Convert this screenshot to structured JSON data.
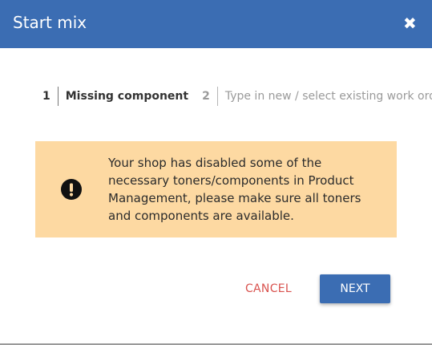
{
  "dialog": {
    "title": "Start mix",
    "close_icon": "close-icon"
  },
  "steps": [
    {
      "number": "1",
      "label": "Missing component",
      "active": true
    },
    {
      "number": "2",
      "label": "Type in new / select existing work order",
      "active": false
    }
  ],
  "alert": {
    "icon": "exclamation-circle-icon",
    "message": "Your shop has disabled some of the necessary toners/components in Product Management, please make sure all toners and components are available.",
    "background_color": "#fdd9a2"
  },
  "actions": {
    "cancel_label": "CANCEL",
    "next_label": "NEXT"
  },
  "colors": {
    "header": "#3b6db3",
    "primary_button": "#3b6db3",
    "cancel_text": "#d9534f"
  }
}
